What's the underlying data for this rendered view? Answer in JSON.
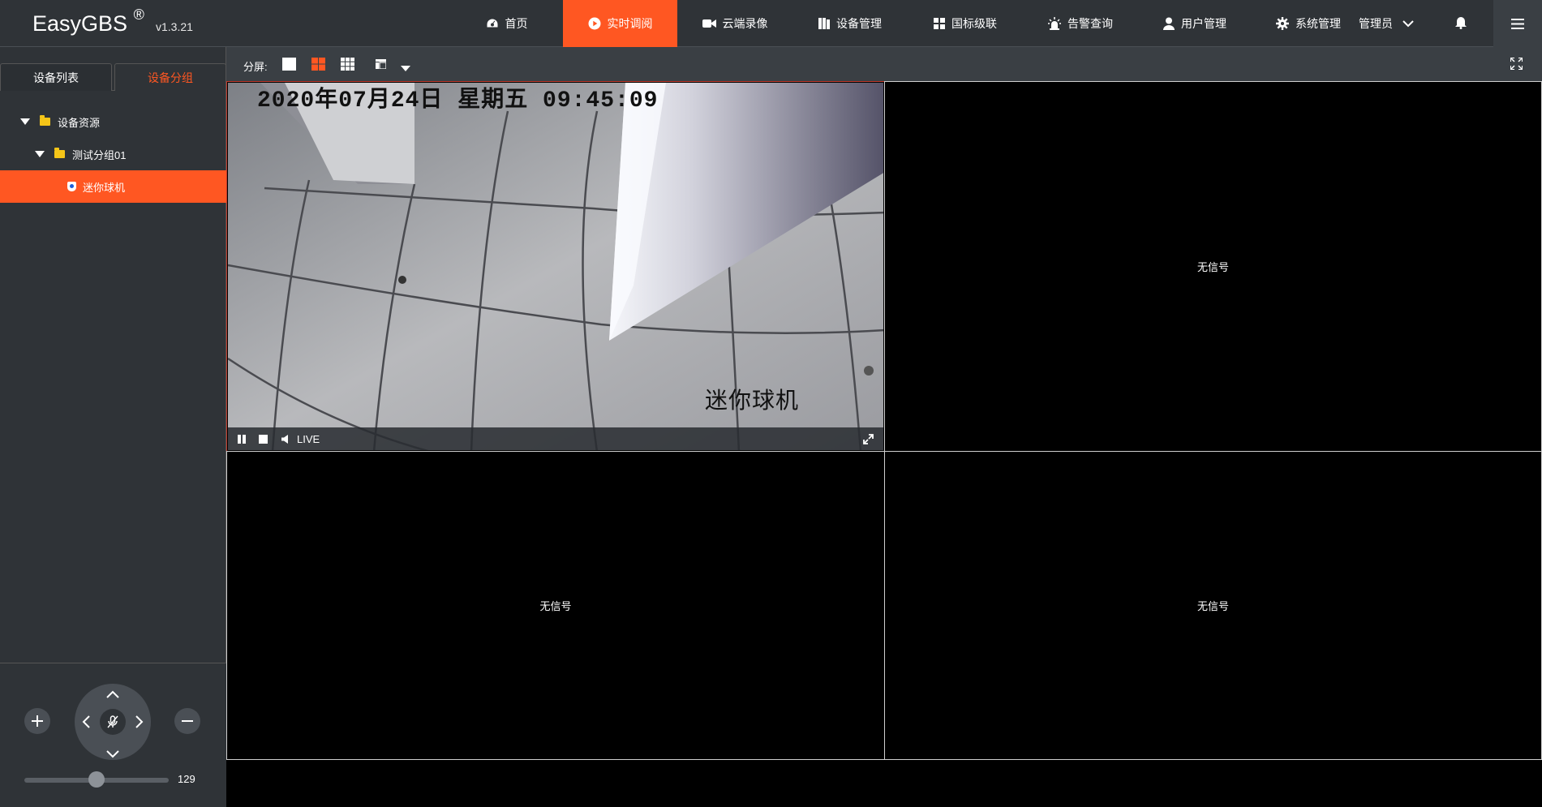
{
  "app": {
    "name": "EasyGBS",
    "registered": "®",
    "version": "v1.3.21"
  },
  "nav": [
    {
      "label": "首页",
      "icon": "dashboard-icon",
      "active": false
    },
    {
      "label": "实时调阅",
      "icon": "play-circle-icon",
      "active": true
    },
    {
      "label": "云端录像",
      "icon": "video-camera-icon",
      "active": false
    },
    {
      "label": "设备管理",
      "icon": "device-icon",
      "active": false
    },
    {
      "label": "国标级联",
      "icon": "cascade-icon",
      "active": false
    },
    {
      "label": "告警查询",
      "icon": "alarm-icon",
      "active": false
    },
    {
      "label": "用户管理",
      "icon": "user-icon",
      "active": false
    },
    {
      "label": "系统管理",
      "icon": "gear-icon",
      "active": false
    }
  ],
  "user": {
    "label": "管理员"
  },
  "sidebar": {
    "tabs": [
      {
        "label": "设备列表",
        "active": false
      },
      {
        "label": "设备分组",
        "active": true
      }
    ],
    "tree": [
      {
        "label": "设备资源",
        "level": 0,
        "type": "folder",
        "expanded": true
      },
      {
        "label": "测试分组01",
        "level": 1,
        "type": "folder",
        "expanded": true
      },
      {
        "label": "迷你球机",
        "level": 2,
        "type": "camera",
        "selected": true
      }
    ]
  },
  "ptz": {
    "speed": "129",
    "speed_fraction": 0.5
  },
  "toolbar": {
    "split_label": "分屏:"
  },
  "player": {
    "osd_time": "2020年07月24日 星期五 09:45:09",
    "osd_name": "迷你球机",
    "live_label": "LIVE",
    "no_signal": "无信号"
  },
  "colors": {
    "accent": "#ff5722",
    "topbar": "#2f3337",
    "folder": "#f5c518"
  }
}
